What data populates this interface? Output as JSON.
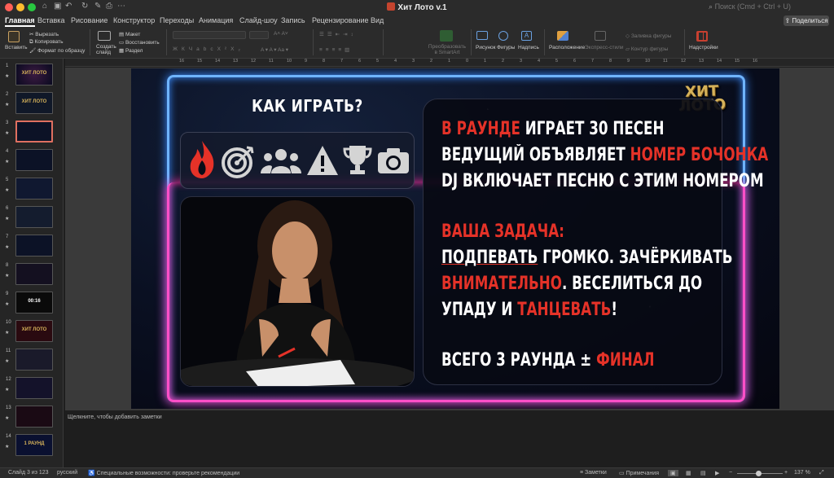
{
  "window": {
    "title": "Хит Лото v.1",
    "search_placeholder": "Поиск (Cmd + Ctrl + U)"
  },
  "tabs": [
    {
      "label": "Главная"
    },
    {
      "label": "Вставка"
    },
    {
      "label": "Рисование"
    },
    {
      "label": "Конструктор"
    },
    {
      "label": "Переходы"
    },
    {
      "label": "Анимация"
    },
    {
      "label": "Слайд-шоу"
    },
    {
      "label": "Запись"
    },
    {
      "label": "Рецензирование"
    },
    {
      "label": "Вид"
    }
  ],
  "share_label": "Поделиться",
  "ribbon": {
    "paste": "Вставить",
    "cut": "Вырезать",
    "copy": "Копировать",
    "format_painter": "Формат по образцу",
    "new_slide": "Создать слайд",
    "layout": "Макет",
    "reset": "Восстановить",
    "section": "Раздел",
    "smartart": "Преобразовать в SmartArt",
    "picture": "Рисунок",
    "shapes": "Фигуры",
    "textbox": "Надпись",
    "arrange": "Расположение",
    "quick_styles": "Экспресс-стили",
    "shape_fill": "Заливка фигуры",
    "shape_outline": "Контур фигуры",
    "addins": "Надстройки"
  },
  "ruler_labels": [
    "16",
    "15",
    "14",
    "13",
    "12",
    "11",
    "10",
    "9",
    "8",
    "7",
    "6",
    "5",
    "4",
    "3",
    "2",
    "1",
    "0",
    "1",
    "2",
    "3",
    "4",
    "5",
    "6",
    "7",
    "8",
    "9",
    "10",
    "11",
    "12",
    "13",
    "14",
    "15",
    "16"
  ],
  "thumbnails": [
    {
      "num": "1",
      "text": "ХИТ ЛОТО"
    },
    {
      "num": "2",
      "text": "ХИТ ЛОТО"
    },
    {
      "num": "3",
      "text": ""
    },
    {
      "num": "4",
      "text": ""
    },
    {
      "num": "5",
      "text": ""
    },
    {
      "num": "6",
      "text": ""
    },
    {
      "num": "7",
      "text": ""
    },
    {
      "num": "8",
      "text": ""
    },
    {
      "num": "9",
      "text": "00:16"
    },
    {
      "num": "10",
      "text": "ХИТ ЛОТО"
    },
    {
      "num": "11",
      "text": ""
    },
    {
      "num": "12",
      "text": ""
    },
    {
      "num": "13",
      "text": ""
    },
    {
      "num": "14",
      "text": "1 РАУНД"
    }
  ],
  "slide": {
    "logo_line1": "ХИТ",
    "logo_line2": "ЛОТО",
    "how_title": "КАК ИГРАТЬ?",
    "line1_red": "В РАУНДЕ",
    "line1_rest": " ИГРАЕТ 30 ПЕСЕН",
    "line2_white": "ВЕДУЩИЙ ОБЪЯВЛЯЕТ ",
    "line2_red": "НОМЕР БОЧОНКА",
    "line3": "DJ ВКЛЮЧАЕТ ПЕСНЮ С ЭТИМ НОМЕРОМ",
    "task_title": "ВАША ЗАДАЧА:",
    "task1_ul": "ПОДПЕВАТЬ",
    "task1_rest": " ГРОМКО. ЗАЧЁРКИВАТЬ",
    "task2_red": "ВНИМАТЕЛЬНО",
    "task2_rest": ". ВЕСЕЛИТЬСЯ ДО",
    "task3_white": "УПАДУ И ",
    "task3_red": "ТАНЦЕВАТЬ",
    "task3_end": "!",
    "total_white": "ВСЕГО 3 РАУНДА ± ",
    "total_red": "ФИНАЛ"
  },
  "notes_placeholder": "Щелкните, чтобы добавить заметки",
  "status": {
    "slide_info": "Слайд 3 из 123",
    "language": "русский",
    "accessibility": "Специальные возможности: проверьте рекомендации",
    "notes_btn": "Заметки",
    "comments_btn": "Примечания",
    "zoom": "137 %"
  },
  "colors": {
    "accent_red": "#e53228",
    "neon_blue": "#6fb4ff",
    "neon_pink": "#ff4fc8",
    "logo_gold": "#d6b25a"
  }
}
